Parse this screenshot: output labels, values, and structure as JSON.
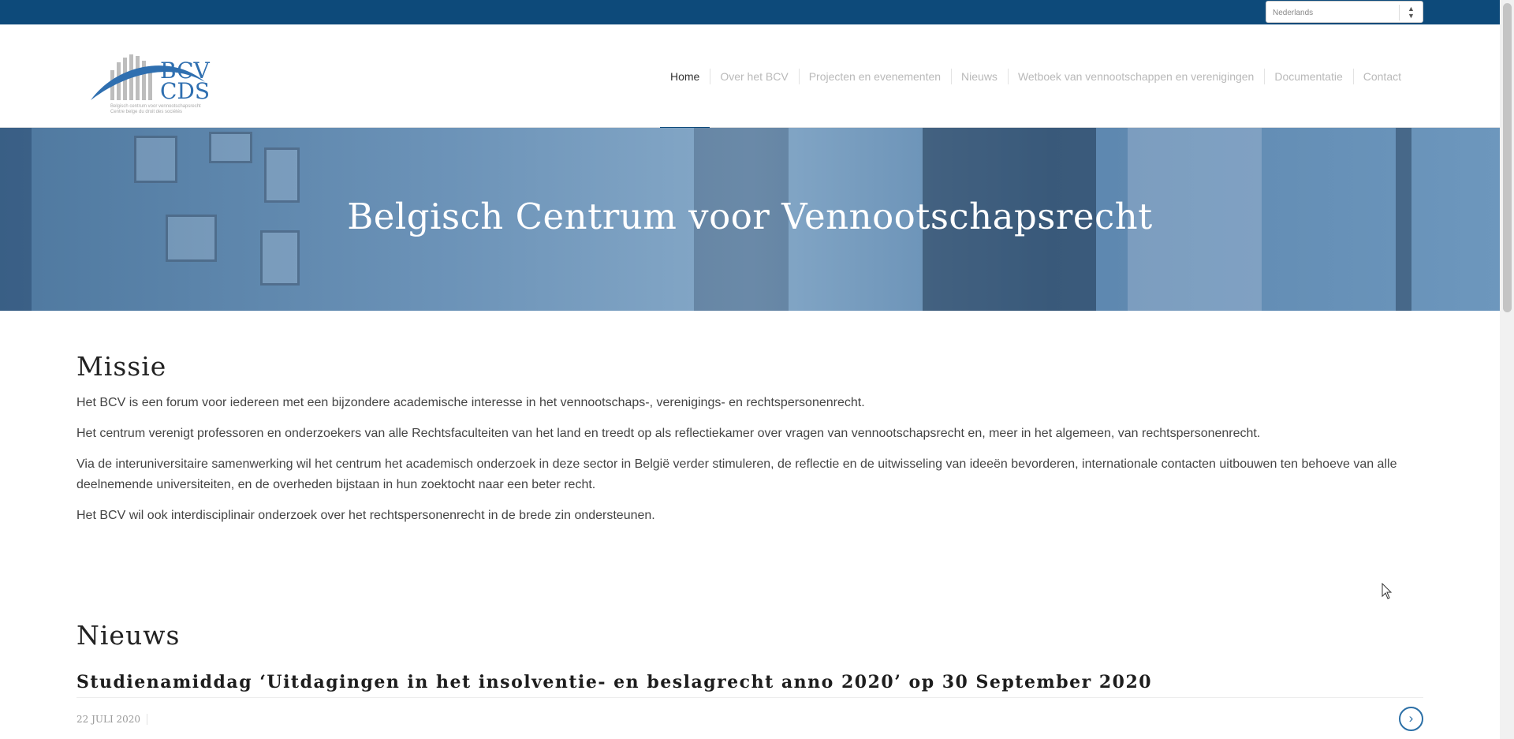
{
  "language_select": {
    "value": "Nederlands"
  },
  "logo": {
    "line1": "BCV",
    "line2": "CDS",
    "subline1": "Belgisch centrum voor vennootschapsrecht",
    "subline2": "Centre belge du droit des sociétés"
  },
  "nav": {
    "items": [
      {
        "label": "Home",
        "active": true
      },
      {
        "label": "Over het BCV"
      },
      {
        "label": "Projecten en evenementen"
      },
      {
        "label": "Nieuws"
      },
      {
        "label": "Wetboek van vennootschappen en verenigingen"
      },
      {
        "label": "Documentatie"
      },
      {
        "label": "Contact"
      }
    ]
  },
  "hero": {
    "title": "Belgisch Centrum voor Vennootschapsrecht"
  },
  "mission": {
    "heading": "Missie",
    "paragraphs": [
      "Het BCV is een forum voor iedereen met een bijzondere academische interesse in het vennootschaps-, verenigings- en rechtspersonenrecht.",
      "Het centrum verenigt professoren en onderzoekers van alle Rechtsfaculteiten van het land en treedt op als reflectiekamer over vragen van vennootschapsrecht en, meer in het algemeen, van rechtspersonenrecht.",
      "Via de interuniversitaire samenwerking wil het centrum het academisch onderzoek in deze sector in België verder stimuleren, de reflectie en de uitwisseling van ideeën bevorderen, internationale contacten uitbouwen ten behoeve van alle deelnemende universiteiten, en de overheden bijstaan in hun zoektocht naar een beter recht.",
      "Het BCV wil ook interdisciplinair onderzoek over het rechtspersonenrecht in de brede zin ondersteunen."
    ]
  },
  "news": {
    "heading": "Nieuws",
    "items": [
      {
        "title": "Studienamiddag ‘Uitdagingen in het insolventie- en beslagrecht anno 2020’ op 30 September 2020",
        "date": "22 JULI 2020"
      }
    ]
  },
  "colors": {
    "topbar": "#0d4a7a",
    "accent": "#2b6fa6",
    "hero_overlay": "#5c86ae"
  }
}
